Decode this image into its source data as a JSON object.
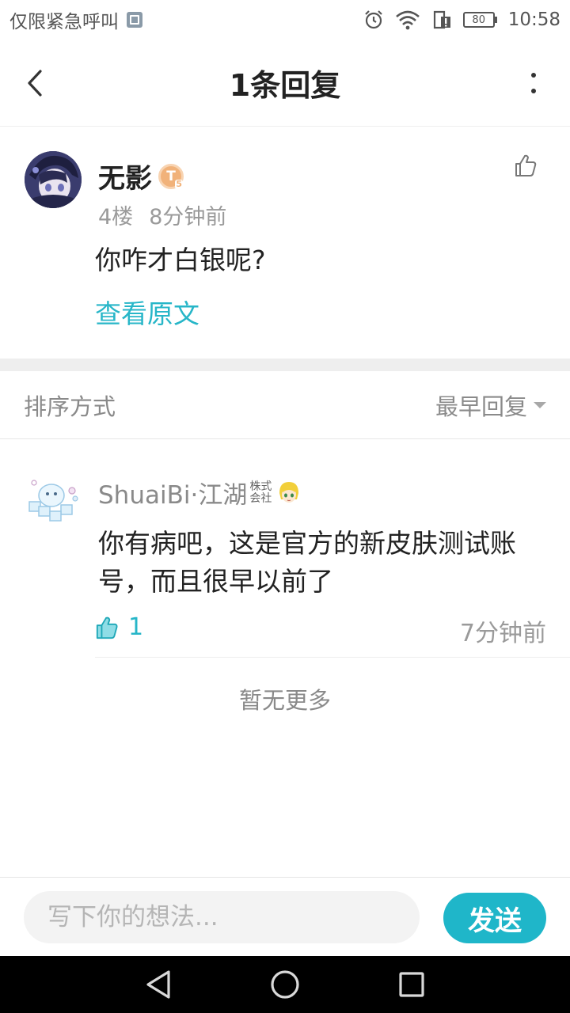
{
  "status_bar": {
    "carrier": "仅限紧急呼叫",
    "battery": "80",
    "time": "10:58",
    "icons": [
      "image-icon",
      "alarm-icon",
      "wifi-icon",
      "sim-alert-icon",
      "battery-icon"
    ]
  },
  "header": {
    "title": "1条回复",
    "back_icon": "chevron-left-icon",
    "more_icon": "more-vertical-icon"
  },
  "post": {
    "author": "无影",
    "level_badge": "T",
    "level_sub": "5",
    "floor": "4楼",
    "time": "8分钟前",
    "content": "你咋才白银呢?",
    "view_original": "查看原文",
    "like_icon": "thumbs-up-outline-icon"
  },
  "sort": {
    "label": "排序方式",
    "value": "最早回复"
  },
  "replies": [
    {
      "author": "ShuaiBi·江湖",
      "tag_top": "株式",
      "tag_bottom": "会社",
      "content": "你有病吧，这是官方的新皮肤测试账号，而且很早以前了",
      "likes": "1",
      "time": "7分钟前"
    }
  ],
  "no_more": "暂无更多",
  "composer": {
    "placeholder": "写下你的想法...",
    "send_label": "发送"
  },
  "colors": {
    "accent": "#1fb6c9",
    "link": "#27b6c8",
    "muted": "#8a8a8a",
    "badge": "#f1b27a"
  }
}
